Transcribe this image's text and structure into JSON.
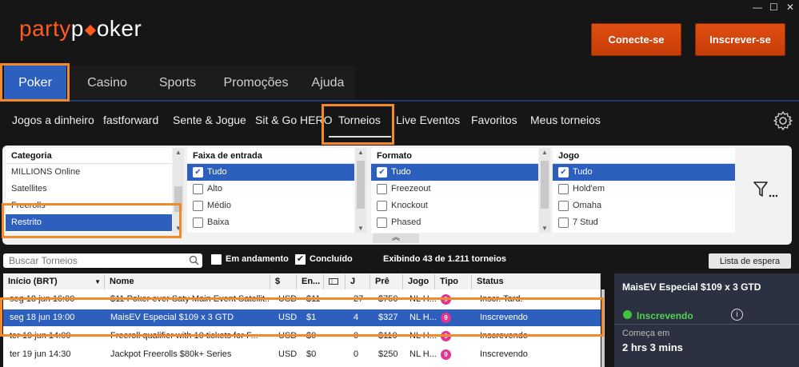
{
  "window": {
    "min": "—",
    "max": "☐",
    "close": "✕"
  },
  "logo": {
    "party": "party",
    "p": "p",
    "oker": "oker"
  },
  "header": {
    "login": "Conecte-se",
    "register": "Inscrever-se"
  },
  "main_nav": [
    "Poker",
    "Casino",
    "Sports",
    "Promoções",
    "Ajuda"
  ],
  "sub_nav": [
    "Jogos a dinheiro",
    "fastforward",
    "Sente & Jogue",
    "Sit & Go HERO",
    "Torneios",
    "Live Eventos",
    "Favoritos",
    "Meus torneios"
  ],
  "filters": {
    "categoria": {
      "header": "Categoria",
      "items": [
        "MILLIONS Online",
        "Satellites",
        "Freerolls",
        "Restrito"
      ]
    },
    "faixa": {
      "header": "Faixa de entrada",
      "items": [
        "Tudo",
        "Alto",
        "Médio",
        "Baixa"
      ]
    },
    "formato": {
      "header": "Formato",
      "items": [
        "Tudo",
        "Freezeout",
        "Knockout",
        "Phased"
      ]
    },
    "jogo": {
      "header": "Jogo",
      "items": [
        "Tudo",
        "Hold'em",
        "Omaha",
        "7 Stud"
      ]
    }
  },
  "toolbar": {
    "search_placeholder": "Buscar Torneios",
    "em_andamento": "Em andamento",
    "concluido": "Concluído",
    "exibindo": "Exibindo 43 de 1.211 torneios",
    "waitlist": "Lista de espera"
  },
  "table": {
    "headers": [
      "Início (BRT)",
      "Nome",
      "$",
      "En...",
      "",
      "J",
      "Prê",
      "Jogo",
      "Tipo",
      "Status"
    ],
    "rows": [
      {
        "inicio": "seg 18 jun 16:00",
        "nome": "$11 Poker ever Saty Main Event Satellit...",
        "moeda": "USD",
        "entrada": "$11",
        "j": "27",
        "pre": "$750",
        "jogo": "NL H...",
        "tipo": "9",
        "status": "Inscr. Tard."
      },
      {
        "inicio": "seg 18 jun 19:00",
        "nome": "MaisEV Especial $109 x 3 GTD",
        "moeda": "USD",
        "entrada": "$1",
        "j": "4",
        "pre": "$327",
        "jogo": "NL H...",
        "tipo": "9",
        "status": "Inscrevendo"
      },
      {
        "inicio": "ter 19 jun 14:00",
        "nome": "Freeroll qualifier with 10 tickets for F...",
        "moeda": "USD",
        "entrada": "$0",
        "j": "0",
        "pre": "$110",
        "jogo": "NL H...",
        "tipo": "9",
        "status": "Inscrevendo"
      },
      {
        "inicio": "ter 19 jun 14:30",
        "nome": "Jackpot Freerolls $80k+ Series",
        "moeda": "USD",
        "entrada": "$0",
        "j": "0",
        "pre": "$250",
        "jogo": "NL H...",
        "tipo": "9",
        "status": "Inscrevendo"
      }
    ]
  },
  "detail": {
    "title": "MaisEV Especial $109 x 3 GTD",
    "status": "Inscrevendo",
    "info": "i",
    "starts_label": "Começa em",
    "starts_value": "2 hrs  3 mins"
  },
  "colors": {
    "accent": "#ff5a1f",
    "selection": "#2d5fbf",
    "highlight": "#f08a2a",
    "status_green": "#3ec43e"
  }
}
